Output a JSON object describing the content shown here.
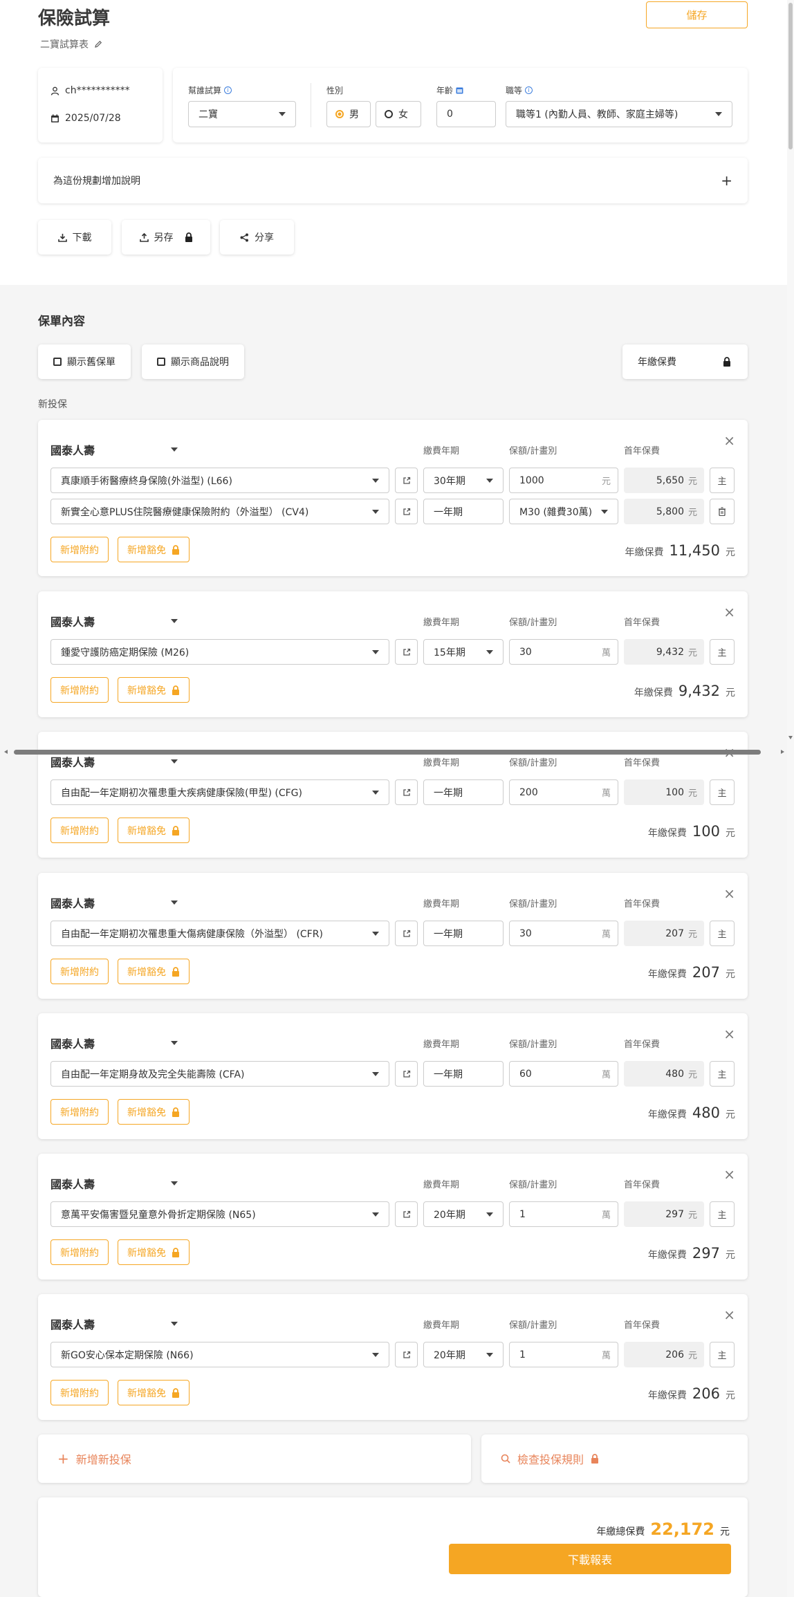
{
  "header": {
    "title": "保險試算",
    "subtitle": "二寶試算表",
    "save_label": "儲存"
  },
  "user": {
    "account": "ch***********",
    "date": "2025/07/28"
  },
  "conditions": {
    "helper_label": "幫誰試算",
    "helper_value": "二寶",
    "gender_label": "性別",
    "male_label": "男",
    "female_label": "女",
    "age_label": "年齡",
    "age_value": "0",
    "occupation_label": "職等",
    "occupation_value": "職等1 (內勤人員、教師、家庭主婦等)"
  },
  "note": {
    "placeholder": "為這份規劃增加說明",
    "plus": "+"
  },
  "actions": {
    "download": "下載",
    "save_as": "另存",
    "share": "分享"
  },
  "policy": {
    "section_title": "保單內容",
    "show_old": "顯示舊保單",
    "show_desc": "顯示商品說明",
    "annual_mode": "年繳保費",
    "new_label": "新投保",
    "col_term": "繳費年期",
    "col_amount": "保額/計畫別",
    "col_premium": "首年保費",
    "add_rider": "新增附約",
    "add_waiver": "新增豁免",
    "annual_label": "年繳保費",
    "yuan": "元",
    "main_tag": "主",
    "close": "×"
  },
  "cards": [
    {
      "company": "國泰人壽",
      "rows": [
        {
          "product": "真康順手術醫療終身保險(外溢型) (L66)",
          "term": "30年期",
          "term_dropdown": true,
          "amount": "1000",
          "unit": "元",
          "premium": "5,650",
          "tag": "主"
        },
        {
          "product": "新實全心意PLUS住院醫療健康保險附約（外溢型） (CV4)",
          "term": "一年期",
          "term_dropdown": false,
          "amount": "M30 (雜費30萬)",
          "amount_dropdown": true,
          "premium": "5,800",
          "tag": "trash"
        }
      ],
      "total": "11,450"
    },
    {
      "company": "國泰人壽",
      "rows": [
        {
          "product": "鍾愛守護防癌定期保險 (M26)",
          "term": "15年期",
          "term_dropdown": true,
          "amount": "30",
          "unit": "萬",
          "premium": "9,432",
          "tag": "主"
        }
      ],
      "total": "9,432"
    },
    {
      "company": "國泰人壽",
      "rows": [
        {
          "product": "自由配一年定期初次罹患重大疾病健康保險(甲型) (CFG)",
          "term": "一年期",
          "term_dropdown": false,
          "amount": "200",
          "unit": "萬",
          "premium": "100",
          "tag": "主"
        }
      ],
      "total": "100"
    },
    {
      "company": "國泰人壽",
      "rows": [
        {
          "product": "自由配一年定期初次罹患重大傷病健康保險（外溢型） (CFR)",
          "term": "一年期",
          "term_dropdown": false,
          "amount": "30",
          "unit": "萬",
          "premium": "207",
          "tag": "主"
        }
      ],
      "total": "207"
    },
    {
      "company": "國泰人壽",
      "rows": [
        {
          "product": "自由配一年定期身故及完全失能壽險 (CFA)",
          "term": "一年期",
          "term_dropdown": false,
          "amount": "60",
          "unit": "萬",
          "premium": "480",
          "tag": "主"
        }
      ],
      "total": "480"
    },
    {
      "company": "國泰人壽",
      "rows": [
        {
          "product": "意萬平安傷害暨兒童意外骨折定期保險 (N65)",
          "term": "20年期",
          "term_dropdown": true,
          "amount": "1",
          "unit": "萬",
          "premium": "297",
          "tag": "主"
        }
      ],
      "total": "297"
    },
    {
      "company": "國泰人壽",
      "rows": [
        {
          "product": "新GO安心保本定期保險 (N66)",
          "term": "20年期",
          "term_dropdown": true,
          "amount": "1",
          "unit": "萬",
          "premium": "206",
          "tag": "主"
        }
      ],
      "total": "206"
    }
  ],
  "bottom": {
    "add_new": "新增新投保",
    "check_rules": "檢查投保規則",
    "total_label": "年繳總保費",
    "total_value": "22,172",
    "total_unit": "元",
    "download_report": "下載報表"
  },
  "colors": {
    "accent": "#f5a623",
    "accent_soft": "#e8845a",
    "info": "#3b7ddd"
  }
}
